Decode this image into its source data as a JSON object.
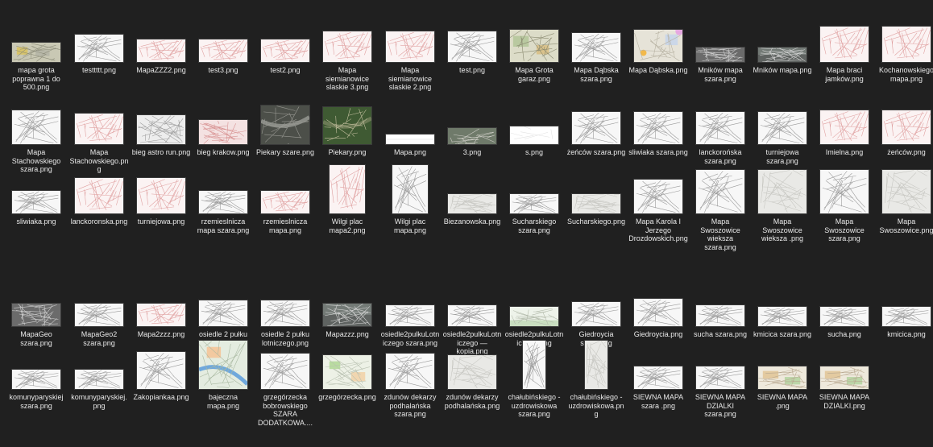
{
  "files": [
    {
      "name": "mapa grota poprawna 1 do 500.png",
      "style": "yellowmap"
    },
    {
      "name": "testtttt.png",
      "style": "lines"
    },
    {
      "name": "MapaZZZ2.png",
      "style": "pinklines"
    },
    {
      "name": "test3.png",
      "style": "pinklines"
    },
    {
      "name": "test2.png",
      "style": "pinklines"
    },
    {
      "name": "Mapa siemianowice slaskie 3.png",
      "style": "pinklines"
    },
    {
      "name": "Mapa siemianowice slaskie 2.png",
      "style": "pinklines"
    },
    {
      "name": "test.png",
      "style": "lines"
    },
    {
      "name": "Mapa Grota garaz.png",
      "style": "colormap"
    },
    {
      "name": "Mapa Dąbska szara.png",
      "style": "lines"
    },
    {
      "name": "Mapa Dąbska.png",
      "style": "colormap2"
    },
    {
      "name": "Mników mapa szara.png",
      "style": "darkgray"
    },
    {
      "name": "Mników mapa.png",
      "style": "darkgray2"
    },
    {
      "name": "Mapa braci jamków.png",
      "style": "pinklines"
    },
    {
      "name": "Kochanowskiego mapa.png",
      "style": "pinklines"
    },
    {
      "name": "Mapa Stachowskiego szara.png",
      "style": "lines"
    },
    {
      "name": "Mapa Stachowskiego.png",
      "style": "pinklines"
    },
    {
      "name": "bieg astro run.png",
      "style": "graymap"
    },
    {
      "name": "bieg krakow.png",
      "style": "pinkmap"
    },
    {
      "name": "Piekary szare.png",
      "style": "darksat"
    },
    {
      "name": "Piekary.png",
      "style": "sat"
    },
    {
      "name": "Mapa.png",
      "style": "whitestrip"
    },
    {
      "name": "3.png",
      "style": "satstrip"
    },
    {
      "name": "s.png",
      "style": "whitestrip2"
    },
    {
      "name": "żeńców szara.png",
      "style": "lines"
    },
    {
      "name": "sliwiaka szara.png",
      "style": "lines"
    },
    {
      "name": "lanckorońska szara.png",
      "style": "lines"
    },
    {
      "name": "turniejowa szara.png",
      "style": "lines"
    },
    {
      "name": "Imielna.png",
      "style": "pinklines"
    },
    {
      "name": "żeńców.png",
      "style": "pinklines"
    },
    {
      "name": "sliwiaka.png",
      "style": "lines"
    },
    {
      "name": "lanckoronska.png",
      "style": "pinklines"
    },
    {
      "name": "turniejowa.png",
      "style": "pinklines"
    },
    {
      "name": "rzemieslnicza mapa szara.png",
      "style": "lines"
    },
    {
      "name": "rzemieslnicza mapa.png",
      "style": "pinklines"
    },
    {
      "name": "Wilgi plac mapa2.png",
      "style": "pinklines"
    },
    {
      "name": "Wilgi plac mapa.png",
      "style": "lines"
    },
    {
      "name": "Biezanowska.png",
      "style": "lightgray"
    },
    {
      "name": "Sucharskiego szara.png",
      "style": "lines"
    },
    {
      "name": "Sucharskiego.png",
      "style": "lightgray"
    },
    {
      "name": "Mapa Karola I Jerzego Drozdowskich.png",
      "style": "lines"
    },
    {
      "name": "Mapa Swoszowice wieksza szara.png",
      "style": "lines"
    },
    {
      "name": "Mapa Swoszowice wieksza .png",
      "style": "lightgray"
    },
    {
      "name": "Mapa Swoszowice szara.png",
      "style": "lines"
    },
    {
      "name": "Mapa Swoszowice.png",
      "style": "lightgray"
    },
    {
      "name": "MapaGeo szara.png",
      "style": "darkgray"
    },
    {
      "name": "MapaGeo2 szara.png",
      "style": "lines"
    },
    {
      "name": "Mapa2zzz.png",
      "style": "pinklines"
    },
    {
      "name": "osiedle 2 pułku lotniczego szara.png",
      "style": "lines"
    },
    {
      "name": "osiedle 2 pułku lotniczego.png",
      "style": "lines"
    },
    {
      "name": "Mapazzz.png",
      "style": "darkgray2"
    },
    {
      "name": "osiedle2pulkuLotniczego szara.png",
      "style": "lines"
    },
    {
      "name": "osiedle2pulkuLotniczego — kopia.png",
      "style": "lines"
    },
    {
      "name": "osiedle2pulkuLotniczego.png",
      "style": "greenish"
    },
    {
      "name": "Giedroycia szara.png",
      "style": "lines"
    },
    {
      "name": "Giedroycia.png",
      "style": "lines"
    },
    {
      "name": "sucha szara.png",
      "style": "lines"
    },
    {
      "name": "kmicica szara.png",
      "style": "lines"
    },
    {
      "name": "sucha.png",
      "style": "lines"
    },
    {
      "name": "kmicica.png",
      "style": "lines"
    },
    {
      "name": "komunyparyskiej szara.png",
      "style": "lines"
    },
    {
      "name": "komunyparyskiej.png",
      "style": "lines"
    },
    {
      "name": "Zakopiankaa.png",
      "style": "lines"
    },
    {
      "name": "bajeczna mapa.png",
      "style": "colormap3"
    },
    {
      "name": "grzegórzecka bobrowskiego SZARA DODATKOWA....",
      "style": "lines"
    },
    {
      "name": "grzegórzecka.png",
      "style": "colormap4"
    },
    {
      "name": "zdunów dekarzy podhalańska szara.png",
      "style": "lines"
    },
    {
      "name": "zdunów dekarzy podhalańska.png",
      "style": "lightgray"
    },
    {
      "name": "chałubińskiego - uzdrowiskowa szara.png",
      "style": "lines"
    },
    {
      "name": "chałubińskiego - uzdrowiskowa.png",
      "style": "lightgray"
    },
    {
      "name": "SIEWNA MAPA szara .png",
      "style": "lines"
    },
    {
      "name": "SIEWNA MAPA DZIALKI szara.png",
      "style": "lines"
    },
    {
      "name": "SIEWNA MAPA .png",
      "style": "colormap5"
    },
    {
      "name": "SIEWNA MAPA DZIALKI.png",
      "style": "colormap5"
    }
  ],
  "colors": {
    "background": "#202020",
    "label": "#e8e8e8"
  }
}
